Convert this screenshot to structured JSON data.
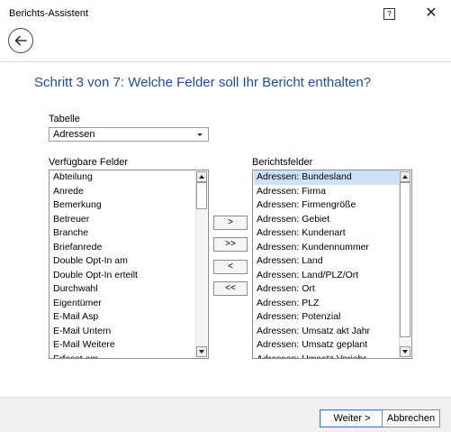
{
  "window": {
    "title": "Berichts-Assistent",
    "help": "?",
    "close": "✕"
  },
  "heading": "Schritt 3 von 7: Welche Felder soll Ihr Bericht enthalten?",
  "table": {
    "label": "Tabelle",
    "value": "Adressen"
  },
  "available": {
    "label": "Verfügbare Felder",
    "items": [
      "Abteilung",
      "Anrede",
      "Bemerkung",
      "Betreuer",
      "Branche",
      "Briefanrede",
      "Double Opt-In am",
      "Double Opt-In erteilt",
      "Durchwahl",
      "Eigentümer",
      "E-Mail Asp",
      "E-Mail Untern",
      "E-Mail Weitere",
      "Erfasst am"
    ],
    "scroll_position": 0
  },
  "report": {
    "label": "Berichtsfelder",
    "items": [
      "Adressen: Bundesland",
      "Adressen: Firma",
      "Adressen: Firmengröße",
      "Adressen: Gebiet",
      "Adressen: Kundenart",
      "Adressen: Kundennummer",
      "Adressen: Land",
      "Adressen: Land/PLZ/Ort",
      "Adressen: Ort",
      "Adressen: PLZ",
      "Adressen: Potenzial",
      "Adressen: Umsatz akt Jahr",
      "Adressen: Umsatz geplant",
      "Adressen: Umsatz Vorjahr"
    ],
    "selected_index": 0,
    "scroll_position": 0
  },
  "move_buttons": {
    "add": ">",
    "add_all": ">>",
    "remove": "<",
    "remove_all": "<<"
  },
  "footer": {
    "next": "Weiter >",
    "cancel": "Abbrechen"
  }
}
